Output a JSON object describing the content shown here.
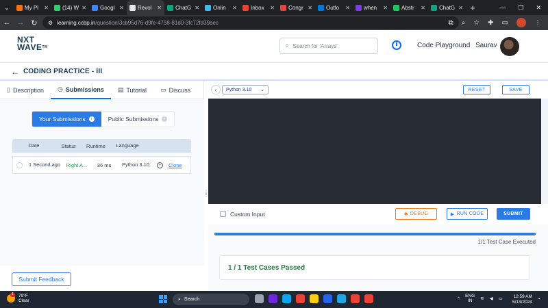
{
  "browser": {
    "tabs": [
      {
        "label": "My Pl",
        "color": "#f97316"
      },
      {
        "label": "(14) W",
        "color": "#25d366"
      },
      {
        "label": "Googl",
        "color": "#4285f4"
      },
      {
        "label": "Revol",
        "color": "#e5e7eb",
        "active": true
      },
      {
        "label": "ChatG",
        "color": "#10a37f"
      },
      {
        "label": "Onlin",
        "color": "#38bdf8"
      },
      {
        "label": "Inbox",
        "color": "#ea4335"
      },
      {
        "label": "Congr",
        "color": "#ea4335"
      },
      {
        "label": "Outlo",
        "color": "#0078d4"
      },
      {
        "label": "when",
        "color": "#7c3aed"
      },
      {
        "label": "Abstr",
        "color": "#22c55e"
      },
      {
        "label": "ChatG",
        "color": "#10a37f"
      }
    ],
    "url_host": "learning.ccbp.in",
    "url_path": "/question/3cb95d76-d9fe-4758-81d0-3fc72fd39aec"
  },
  "header": {
    "logo_line1": "NXT",
    "logo_line2": "WAVE",
    "logo_tm": "TM",
    "search_placeholder": "Search for 'Arrays'",
    "code_playground": "Code Playground",
    "user_name": "Saurav"
  },
  "page": {
    "title": "CODING PRACTICE - III"
  },
  "left_tabs": [
    {
      "label": "Description",
      "icon": "document-icon"
    },
    {
      "label": "Submissions",
      "icon": "clock-icon",
      "active": true
    },
    {
      "label": "Tutorial",
      "icon": "book-icon"
    },
    {
      "label": "Discuss",
      "icon": "chat-icon"
    }
  ],
  "submissions": {
    "toggle_yours": "Your Submissions",
    "toggle_public": "Public Submissions",
    "columns": {
      "date": "Date",
      "status": "Status",
      "runtime": "Runtime",
      "language": "Language"
    },
    "rows": [
      {
        "date": "1 Second ago",
        "status": "Right A...",
        "runtime": "36 ms",
        "language": "Python 3.10",
        "action": "Clone"
      }
    ]
  },
  "feedback_button": "Submit Feedback",
  "editor": {
    "language": "Python 3.10",
    "reset": "RESET",
    "save": "SAVE",
    "custom_input": "Custom Input",
    "debug": "DEBUG",
    "run_code": "RUN CODE",
    "submit": "SUBMIT",
    "progress": 1.0,
    "executed": "1/1 Test Case Executed",
    "result": "1 / 1 Test Cases Passed",
    "accent": "#2c7be5",
    "success": "#15803d"
  },
  "taskbar": {
    "temp": "79°F",
    "condition": "Clear",
    "badge": "1",
    "search": "Search",
    "lang_top": "ENG",
    "lang_bottom": "IN",
    "time": "12:59 AM",
    "date": "5/13/2024"
  }
}
